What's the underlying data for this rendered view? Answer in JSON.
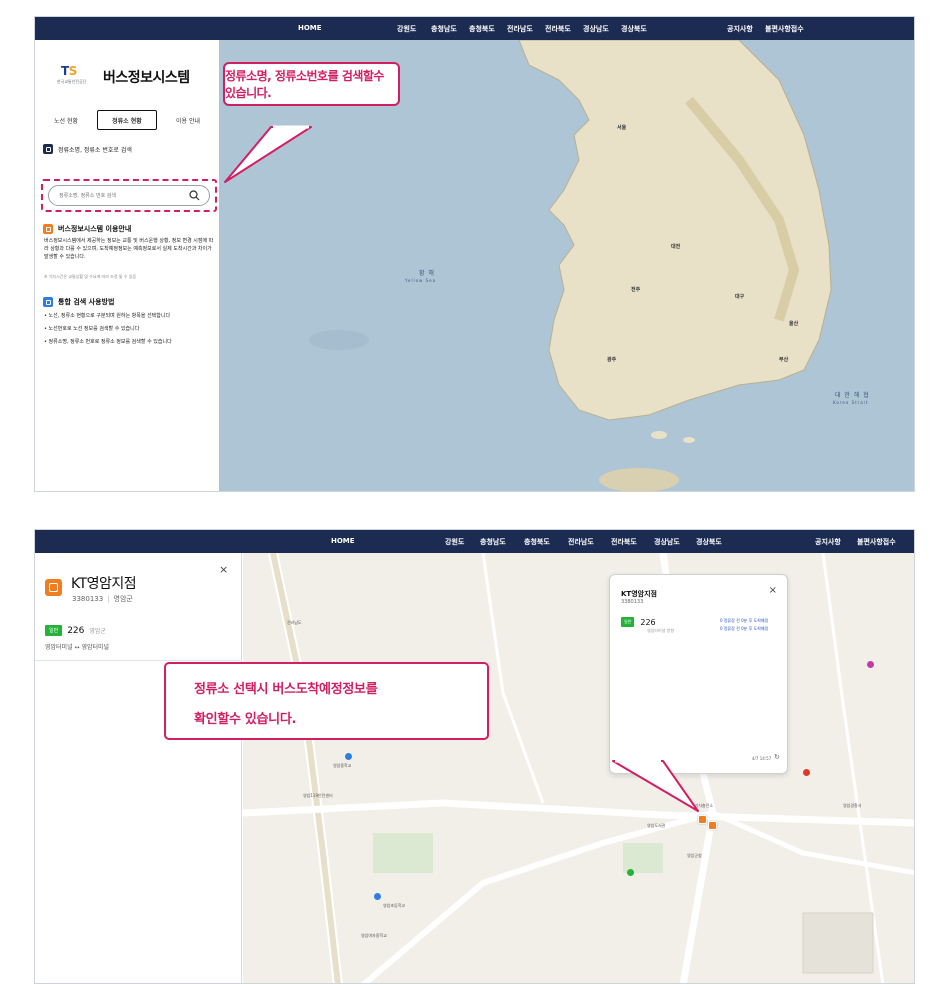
{
  "nav": {
    "home": "HOME",
    "regions": [
      "강원도",
      "충청남도",
      "충청북도",
      "전라남도",
      "전라북도",
      "경상남도",
      "경상북도"
    ],
    "notice": "공지사항",
    "complaint": "불편사항접수"
  },
  "screen1": {
    "logo": {
      "mark": "TS",
      "sub": "한국교통안전공단",
      "title": "버스정보시스템"
    },
    "tabs": [
      {
        "label": "노선 현황",
        "active": false
      },
      {
        "label": "정류소 현황",
        "active": true
      },
      {
        "label": "이용 안내",
        "active": false
      }
    ],
    "search": {
      "section_label": "정류소명, 정류소 번호로 검색",
      "placeholder": "정류소명, 정류소 번호 검색"
    },
    "info": {
      "title": "버스정보시스템 이용안내",
      "body": "버스정보시스템에서 제공하는 정보는 교통 및 버스운행 상황, 정보 변경 시점에 따라 상황과 다를 수 있으며, 도착예정정보는 예측정보로서 실제 도착시간과 차이가 발생할 수 있습니다.",
      "note": "※ 익차시간은 교통상황 및 수요에 따라 조정 될 수 있음"
    },
    "usage": {
      "title": "통합 검색 사용방법",
      "items": [
        "노선, 정류소 현황으로 구분되며 원하는 항목을 선택합니다",
        "노선번호로 노선 정보를 검색할 수 있습니다",
        "정류소명, 정류소 번호로 정류소 정보를 검색할 수 있습니다"
      ]
    },
    "map": {
      "sea_west": "황 해",
      "sea_west_en": "Yellow Sea",
      "sea_east": "대 한 해 협",
      "sea_east_en": "Korea Strait",
      "cities": [
        "서울",
        "대전",
        "대구",
        "울산",
        "부산",
        "광주",
        "전주"
      ]
    },
    "callout": "정류소명, 정류소번호를 검색할수 있습니다."
  },
  "screen2": {
    "nav": {
      "home": "HOME",
      "regions": [
        "강원도",
        "충청남도",
        "충청북도",
        "전라남도",
        "전라북도",
        "경상남도",
        "경상북도"
      ],
      "notice": "공지사항",
      "complaint": "불편사항접수"
    },
    "stop": {
      "name": "KT영암지점",
      "id": "3380133",
      "area": "영암군",
      "close": "×",
      "route": {
        "badge": "일반",
        "number": "226",
        "area": "영암군",
        "direction": "영암터미널 ↔ 영암터미널"
      }
    },
    "popup": {
      "name": "KT영암지점",
      "id": "3380133",
      "close": "×",
      "route": {
        "badge": "일반",
        "number": "226",
        "direction": "영암터미널 방향"
      },
      "arrivals": [
        "0 정류장 전 0분 후 도착예정",
        "0 정류장 전 0분 후 도착예정"
      ],
      "time": "4/7 14:57",
      "refresh": "↻"
    },
    "callout": {
      "line1": "정류소 선택시 버스도착예정정보를",
      "line2": "확인할수 있습니다."
    },
    "pois": [
      "영암군청",
      "영암도서관",
      "영암경찰서",
      "영암초등학교",
      "영암중학교",
      "전기차충전소",
      "영암여자중학교",
      "영암119안전센터"
    ]
  },
  "colors": {
    "nav": "#1b2b52",
    "accent": "#d01f63",
    "bus": "#ef7d22",
    "badge": "#23b33a"
  }
}
